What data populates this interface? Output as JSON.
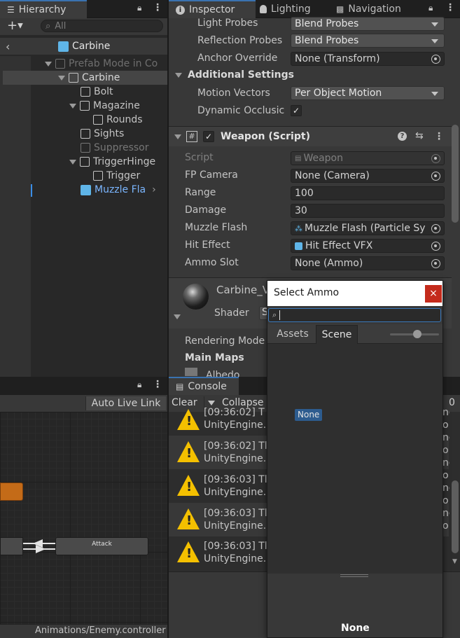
{
  "hierarchy": {
    "tab": "Hierarchy",
    "search_placeholder": "All",
    "breadcrumb": "Carbine",
    "items": [
      {
        "label": "Prefab Mode in Co"
      },
      {
        "label": "Carbine"
      },
      {
        "label": "Bolt"
      },
      {
        "label": "Magazine"
      },
      {
        "label": "Rounds"
      },
      {
        "label": "Sights"
      },
      {
        "label": "Suppressor"
      },
      {
        "label": "TriggerHinge"
      },
      {
        "label": "Trigger"
      },
      {
        "label": "Muzzle Fla"
      }
    ]
  },
  "inspector": {
    "tabs": [
      "Inspector",
      "Lighting",
      "Navigation"
    ],
    "light_probes": {
      "label": "Light Probes",
      "value": "Blend Probes"
    },
    "reflection_probes": {
      "label": "Reflection Probes",
      "value": "Blend Probes"
    },
    "anchor_override": {
      "label": "Anchor Override",
      "value": "None (Transform)"
    },
    "additional_settings": "Additional Settings",
    "motion_vectors": {
      "label": "Motion Vectors",
      "value": "Per Object Motion"
    },
    "dynamic_occlusion": {
      "label": "Dynamic Occlusic",
      "checkmark": "✓"
    },
    "component": {
      "title": "Weapon (Script)",
      "script": {
        "label": "Script",
        "value": "Weapon"
      },
      "fp_camera": {
        "label": "FP Camera",
        "value": "None (Camera)"
      },
      "range": {
        "label": "Range",
        "value": "100"
      },
      "damage": {
        "label": "Damage",
        "value": "30"
      },
      "muzzle_flash": {
        "label": "Muzzle Flash",
        "value": "Muzzle Flash (Particle Sy"
      },
      "hit_effect": {
        "label": "Hit Effect",
        "value": "Hit Effect VFX"
      },
      "ammo_slot": {
        "label": "Ammo Slot",
        "value": "None (Ammo)"
      }
    },
    "material": {
      "name": "Carbine_V",
      "shader_label": "Shader",
      "shader_value": "S",
      "rendering_mode": "Rendering Mode",
      "main_maps": "Main Maps",
      "albedo": "Albedo"
    }
  },
  "animator": {
    "auto_live_link": "Auto Live Link",
    "state_attack": "Attack",
    "footer_path": "Animations/Enemy.controller"
  },
  "console": {
    "tab": "Console",
    "clear": "Clear",
    "collapse": "Collapse",
    "count": "0",
    "entries": [
      {
        "time": "[09:36:02] T",
        "line2": "UnityEngine."
      },
      {
        "time": "[09:36:02] Tl",
        "line2": "UnityEngine."
      },
      {
        "time": "[09:36:03] Tl",
        "line2": "UnityEngine."
      },
      {
        "time": "[09:36:03] Tl",
        "line2": "UnityEngine."
      },
      {
        "time": "[09:36:03] Tl",
        "line2": "UnityEngine."
      }
    ],
    "right_fragments": [
      "nc",
      "nc",
      "nc",
      "nc",
      "nc"
    ],
    "right_fragments_b": [
      "o",
      "o",
      "o",
      "o",
      "o"
    ]
  },
  "select_ammo": {
    "title": "Select Ammo",
    "close": "×",
    "tabs": [
      "Assets",
      "Scene"
    ],
    "none_item": "None",
    "footer_label": "None"
  }
}
